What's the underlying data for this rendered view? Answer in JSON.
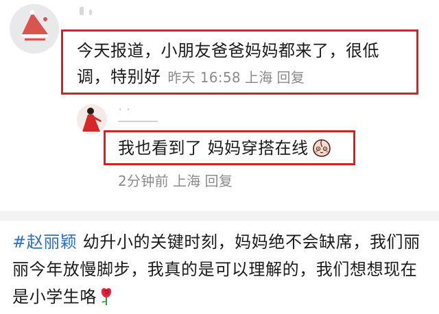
{
  "comment": {
    "text": "今天报道，小朋友爸爸妈妈都来了，很低调，特别好",
    "time": "昨天 16:58",
    "location": "上海",
    "reply_label": "回复"
  },
  "reply": {
    "text": "我也看到了 妈妈穿搭在线",
    "emoji": "peach-face-emoji",
    "time": "2分钟前",
    "location": "上海",
    "reply_label": "回复"
  },
  "post": {
    "hashtag": "#赵丽颖",
    "text": " 幼升小的关键时刻，妈妈绝不会缺席，我们丽丽今年放慢脚步，我真的是可以理解的，我们想想现在是小学生咯",
    "emoji": "rose-emoji"
  },
  "colors": {
    "highlight_border": "#d92020",
    "meta_gray": "#8a8a8a",
    "hashtag_blue": "#2d6fc2",
    "divider_gray": "#f3f3f3"
  }
}
